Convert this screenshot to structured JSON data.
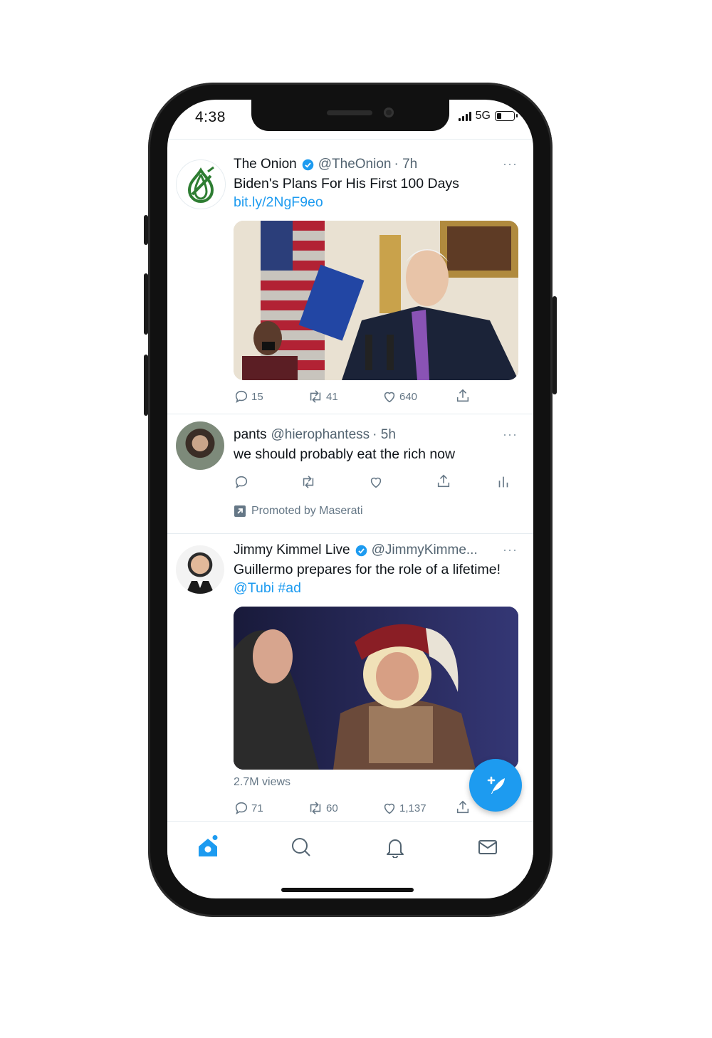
{
  "status_bar": {
    "time": "4:38",
    "network": "5G",
    "battery_level": 0.25
  },
  "colors": {
    "accent": "#1d9bf0",
    "text": "#0f1419",
    "muted": "#657786"
  },
  "tweets": [
    {
      "name": "The Onion",
      "handle": "@TheOnion",
      "time": "· 7h",
      "verified": true,
      "text": "Biden's Plans For His First 100 Days",
      "link": "bit.ly/2NgF9eo",
      "more": "···",
      "actions": {
        "reply": "15",
        "retweet": "41",
        "like": "640"
      }
    },
    {
      "name": "pants",
      "handle": "@hierophantess",
      "time": "· 5h",
      "text": "we should probably eat the rich now",
      "more": "···",
      "promoted": "Promoted by Maserati"
    },
    {
      "name": "Jimmy Kimmel Live",
      "handle": "@JimmyKimme...",
      "verified": true,
      "text": "Guillermo prepares for the role of a lifetime!",
      "mentions": "@Tubi #ad",
      "more": "···",
      "views": "2.7M views",
      "actions": {
        "reply": "71",
        "retweet": "60",
        "like": "1,137"
      }
    }
  ],
  "tab_bar": {
    "items": [
      {
        "icon": "home-icon",
        "active": true
      },
      {
        "icon": "search-icon"
      },
      {
        "icon": "bell-icon"
      },
      {
        "icon": "mail-icon"
      }
    ]
  }
}
